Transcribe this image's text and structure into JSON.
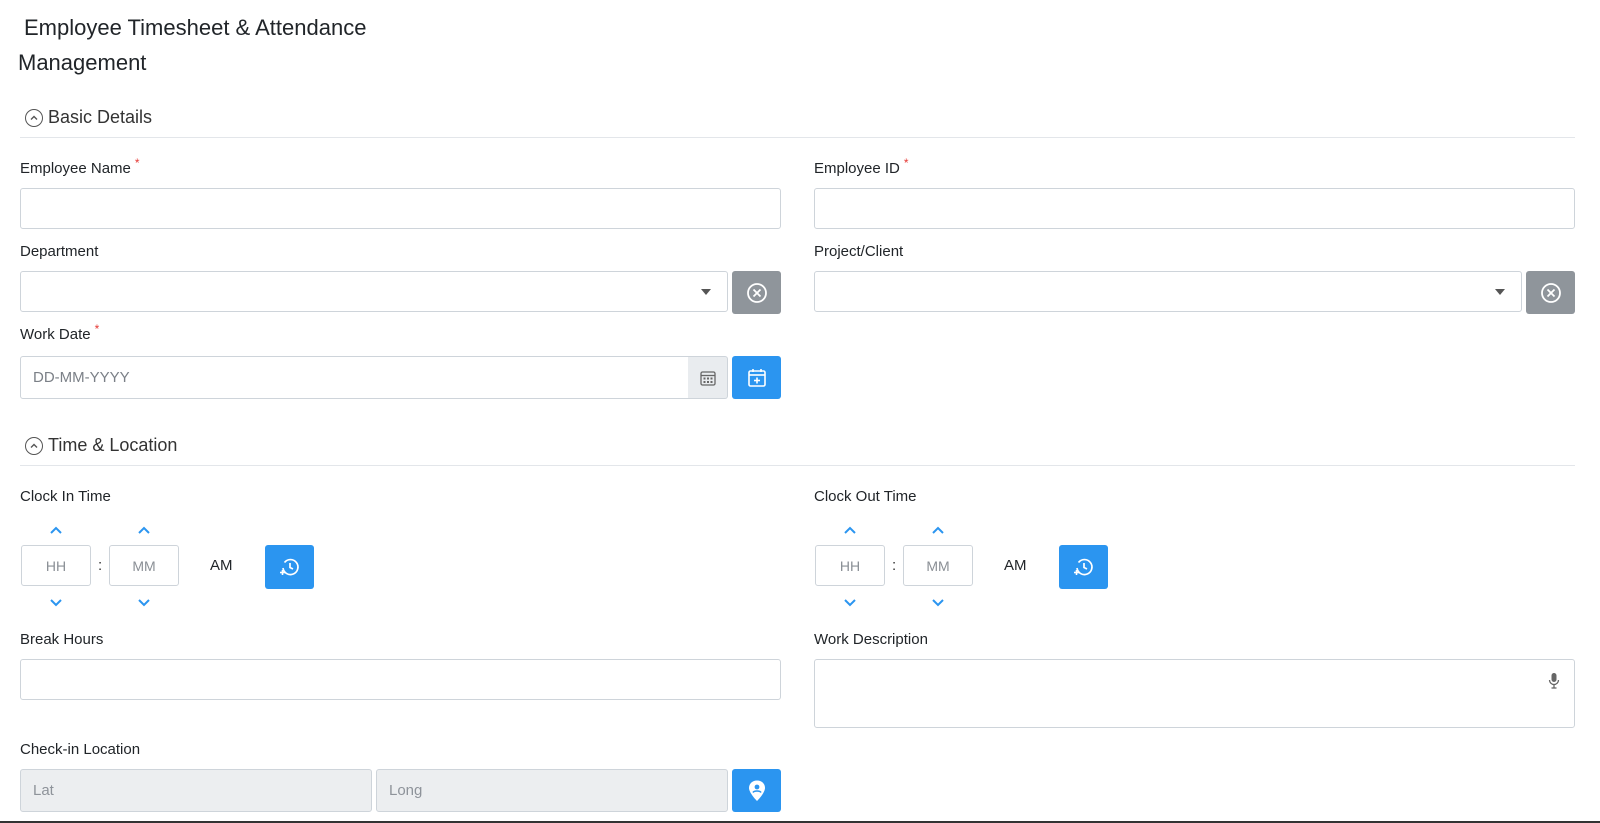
{
  "page": {
    "title_line1": "Employee Timesheet & Attendance",
    "title_line2": "Management"
  },
  "colors": {
    "primary": "#2b95f0",
    "secondary": "#8f959b",
    "required": "#e53935"
  },
  "sections": {
    "basic": {
      "title": "Basic Details"
    },
    "time": {
      "title": "Time & Location"
    }
  },
  "fields": {
    "employee_name": {
      "label": "Employee Name",
      "required": "*",
      "value": ""
    },
    "employee_id": {
      "label": "Employee ID",
      "required": "*",
      "value": ""
    },
    "department": {
      "label": "Department",
      "value": ""
    },
    "project_client": {
      "label": "Project/Client",
      "value": ""
    },
    "work_date": {
      "label": "Work Date",
      "required": "*",
      "placeholder": "DD-MM-YYYY"
    },
    "clock_in": {
      "label": "Clock In Time",
      "hh": "HH",
      "colon": ":",
      "mm": "MM",
      "ampm": "AM"
    },
    "clock_out": {
      "label": "Clock Out Time",
      "hh": "HH",
      "colon": ":",
      "mm": "MM",
      "ampm": "AM"
    },
    "break_hours": {
      "label": "Break Hours",
      "value": ""
    },
    "work_description": {
      "label": "Work Description",
      "value": ""
    },
    "checkin_location": {
      "label": "Check-in Location",
      "lat_placeholder": "Lat",
      "long_placeholder": "Long"
    }
  },
  "icons": {
    "section_toggle": "chevron-up-circle-icon",
    "clear": "close-circle-icon",
    "calendar": "calendar-icon",
    "calendar_add": "calendar-plus-icon",
    "time_now": "clock-history-icon",
    "spinner_up": "chevron-up-icon",
    "spinner_down": "chevron-down-icon",
    "microphone": "microphone-icon",
    "location": "location-pin-icon"
  }
}
